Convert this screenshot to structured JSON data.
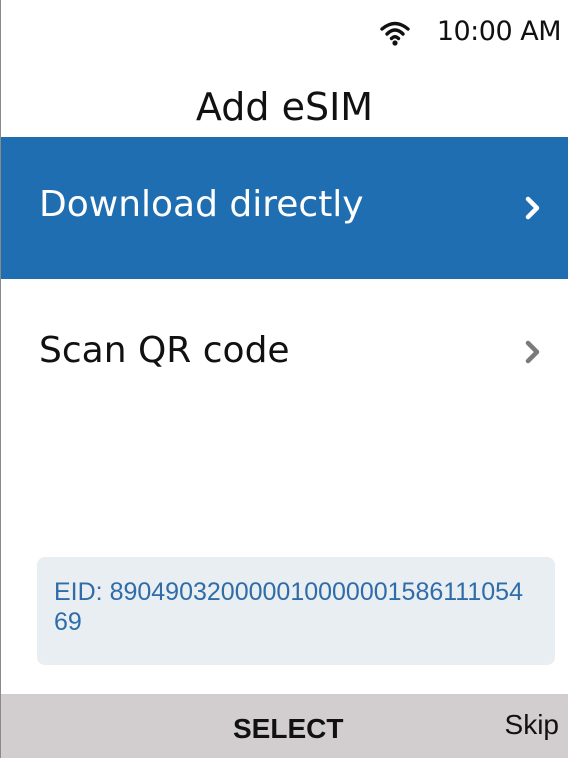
{
  "status_bar": {
    "wifi_icon": "wifi-icon",
    "time": "10:00 AM"
  },
  "page": {
    "title": "Add eSIM"
  },
  "options": [
    {
      "label": "Download directly",
      "selected": true,
      "icon": "chevron-right-icon"
    },
    {
      "label": "Scan QR code",
      "selected": false,
      "icon": "chevron-right-icon"
    }
  ],
  "eid": {
    "text": "EID: 89049032000001000000158611105469"
  },
  "bottom_bar": {
    "select_label": "SELECT",
    "skip_label": "Skip"
  },
  "colors": {
    "selected_row": "#1f6eb1",
    "eid_text": "#2f6ca8",
    "eid_background": "#e8eef1",
    "bottom_bar": "#d2ced0",
    "chevron_inactive": "#7a7a7a"
  }
}
